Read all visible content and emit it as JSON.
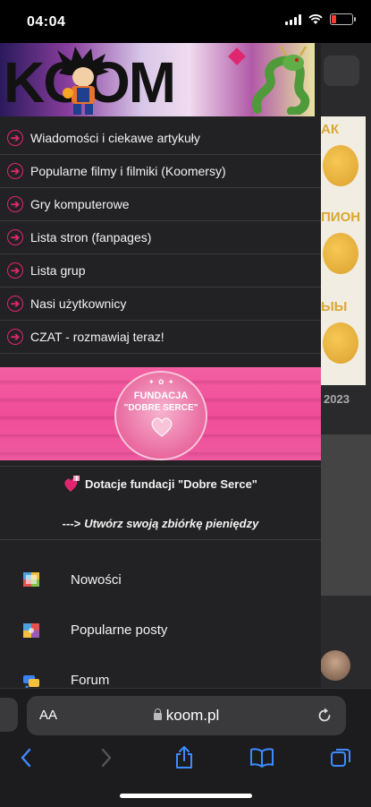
{
  "status": {
    "time": "04:04",
    "battery_color": "#ff3b30"
  },
  "background": {
    "zodiac_words": [
      "АК",
      "ПИОН",
      "ЫЫ"
    ],
    "year": "2023"
  },
  "banner": {
    "logo_text": "KOOM",
    "accent": "#e0266f"
  },
  "menu": {
    "items": [
      {
        "label": "Wiadomości i ciekawe artykuły"
      },
      {
        "label": "Popularne filmy i filmiki (Koomersy)"
      },
      {
        "label": "Gry komputerowe"
      },
      {
        "label": "Lista stron (fanpages)"
      },
      {
        "label": "Lista grup"
      },
      {
        "label": "Nasi użytkownicy"
      },
      {
        "label": "CZAT - rozmawiaj teraz!"
      }
    ]
  },
  "fundacja": {
    "title_line1": "FUNDACJA",
    "title_line2": "\"DOBRE SERCE\""
  },
  "donations": {
    "label": "Dotacje fundacji \"Dobre Serce\""
  },
  "create": {
    "prefix": "--->",
    "link": "Utwórz swoją zbiórkę pieniędzy"
  },
  "nav": {
    "items": [
      {
        "label": "Nowości",
        "icon": "news-icon"
      },
      {
        "label": "Popularne posty",
        "icon": "popular-posts-icon"
      },
      {
        "label": "Forum",
        "icon": "forum-icon"
      }
    ]
  },
  "browser": {
    "aa_label": "AA",
    "url": "koom.pl"
  }
}
